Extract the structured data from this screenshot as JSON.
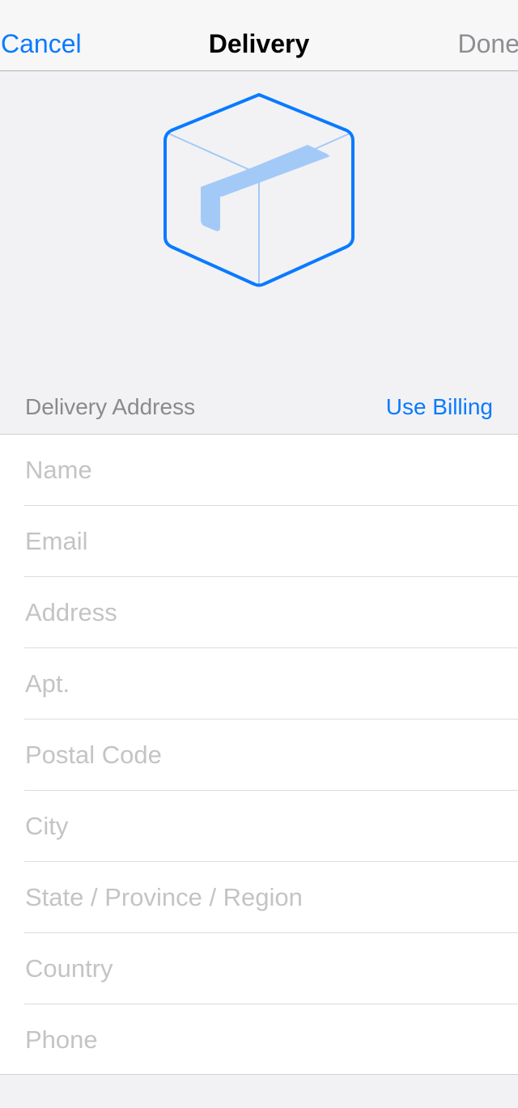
{
  "navbar": {
    "cancel_label": "Cancel",
    "title": "Delivery",
    "done_label": "Done"
  },
  "hero": {
    "icon": "package-box-icon",
    "stroke_color": "#0a7aff",
    "tape_color": "#a3c9f7"
  },
  "section": {
    "title": "Delivery Address",
    "action_label": "Use Billing"
  },
  "form": {
    "fields": [
      {
        "placeholder": "Name",
        "value": ""
      },
      {
        "placeholder": "Email",
        "value": ""
      },
      {
        "placeholder": "Address",
        "value": ""
      },
      {
        "placeholder": "Apt.",
        "value": ""
      },
      {
        "placeholder": "Postal Code",
        "value": ""
      },
      {
        "placeholder": "City",
        "value": ""
      },
      {
        "placeholder": "State / Province / Region",
        "value": ""
      },
      {
        "placeholder": "Country",
        "value": ""
      },
      {
        "placeholder": "Phone",
        "value": ""
      }
    ]
  },
  "colors": {
    "accent": "#0a7aff",
    "disabled": "#8e8e93",
    "background": "#f2f2f4"
  }
}
